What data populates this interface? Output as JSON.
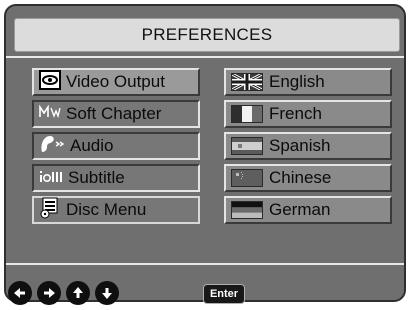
{
  "title": "PREFERENCES",
  "menu": {
    "items": [
      {
        "label": "Video Output",
        "icon": "video-output-icon"
      },
      {
        "label": "Soft Chapter",
        "icon": "soft-chapter-icon"
      },
      {
        "label": "Audio",
        "icon": "audio-icon"
      },
      {
        "label": "Subtitle",
        "icon": "subtitle-icon"
      },
      {
        "label": "Disc Menu",
        "icon": "disc-menu-icon"
      }
    ]
  },
  "languages": {
    "items": [
      {
        "label": "English",
        "flag": "uk-flag-icon"
      },
      {
        "label": "French",
        "flag": "france-flag-icon"
      },
      {
        "label": "Spanish",
        "flag": "spain-flag-icon"
      },
      {
        "label": "Chinese",
        "flag": "china-flag-icon"
      },
      {
        "label": "German",
        "flag": "germany-flag-icon"
      }
    ]
  },
  "footer": {
    "nav_icons": [
      "left-arrow-icon",
      "right-arrow-icon",
      "up-arrow-icon",
      "down-arrow-icon"
    ],
    "enter_label": "Enter"
  },
  "colors": {
    "panel": "#6f6f6f",
    "button_face": "#9a9a9a",
    "selected_face": "#777777"
  }
}
